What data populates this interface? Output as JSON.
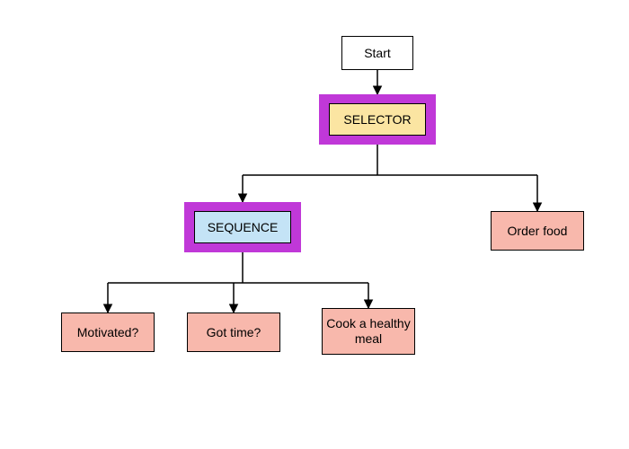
{
  "nodes": {
    "start": "Start",
    "selector": "SELECTOR",
    "sequence": "SEQUENCE",
    "order_food": "Order food",
    "motivated": "Motivated?",
    "got_time": "Got time?",
    "cook": "Cook a healthy meal"
  },
  "colors": {
    "highlight_border": "#c038d8",
    "selector_fill": "#fbe5a2",
    "sequence_fill": "#c4e3f6",
    "leaf_fill": "#f8b8ac",
    "start_fill": "#ffffff",
    "edge": "#000000"
  },
  "diagram": {
    "type": "behavior-tree",
    "root": "Start",
    "edges": [
      [
        "Start",
        "SELECTOR"
      ],
      [
        "SELECTOR",
        "SEQUENCE"
      ],
      [
        "SELECTOR",
        "Order food"
      ],
      [
        "SEQUENCE",
        "Motivated?"
      ],
      [
        "SEQUENCE",
        "Got time?"
      ],
      [
        "SEQUENCE",
        "Cook a healthy meal"
      ]
    ]
  }
}
